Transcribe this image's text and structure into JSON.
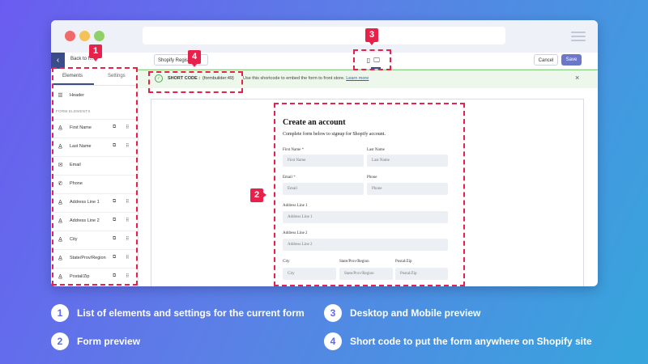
{
  "topbar": {
    "back_label": "Back to f...",
    "form_name": "Shopify Regist...",
    "cancel_label": "Cancel",
    "save_label": "Save"
  },
  "sidebar": {
    "tabs": [
      "Elements",
      "Settings"
    ],
    "header_item": "Header",
    "section_label": "FORM ELEMENTS",
    "elements": [
      {
        "label": "First Name",
        "icon": "text-field-icon"
      },
      {
        "label": "Last Name",
        "icon": "text-field-icon"
      },
      {
        "label": "Email",
        "icon": "mail-icon"
      },
      {
        "label": "Phone",
        "icon": "phone-icon"
      },
      {
        "label": "Address Line 1",
        "icon": "text-field-icon"
      },
      {
        "label": "Address Line 2",
        "icon": "text-field-icon"
      },
      {
        "label": "City",
        "icon": "text-field-icon"
      },
      {
        "label": "State/Prov/Region",
        "icon": "text-field-icon"
      },
      {
        "label": "Postal/Zip",
        "icon": "text-field-icon"
      }
    ]
  },
  "shortcode": {
    "label": "SHORT CODE :",
    "code": "{formbuilder:49}",
    "hint": "Use this shortcode to embed the form to front store.",
    "link": "Learn more"
  },
  "form": {
    "title": "Create an account",
    "subtitle": "Complete form below to signup for Shopify account.",
    "fields": {
      "first_name": {
        "label": "First Name",
        "placeholder": "First Name",
        "required": "*"
      },
      "last_name": {
        "label": "Last Name",
        "placeholder": "Last Name"
      },
      "email": {
        "label": "Email",
        "placeholder": "Email",
        "required": "*"
      },
      "phone": {
        "label": "Phone",
        "placeholder": "Phone"
      },
      "address1": {
        "label": "Address Line 1",
        "placeholder": "Address Line 1"
      },
      "address2": {
        "label": "Address Line 2",
        "placeholder": "Address Line 2"
      },
      "city": {
        "label": "City",
        "placeholder": "City"
      },
      "state": {
        "label": "State/Prov/Region",
        "placeholder": "State/Prov/Region"
      },
      "zip": {
        "label": "Postal/Zip",
        "placeholder": "Postal/Zip"
      }
    }
  },
  "callouts": [
    "1",
    "2",
    "3",
    "4"
  ],
  "legend": [
    {
      "num": "1",
      "text": "List of elements and settings for the current form"
    },
    {
      "num": "2",
      "text": "Form preview"
    },
    {
      "num": "3",
      "text": "Desktop and Mobile preview"
    },
    {
      "num": "4",
      "text": "Short code to put the form anywhere on Shopify site"
    }
  ],
  "colors": {
    "accent": "#e8214b",
    "brand": "#3a4c8a",
    "save": "#6b78c9"
  }
}
